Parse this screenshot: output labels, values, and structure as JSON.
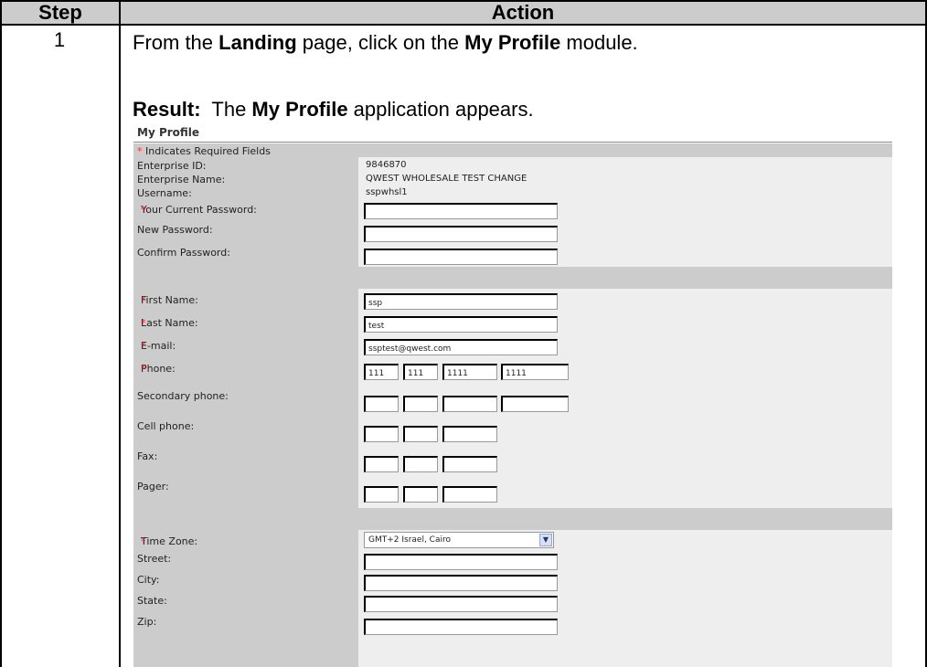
{
  "table": {
    "header_step": "Step",
    "header_action": "Action",
    "step_number": "1",
    "line1_a": "From the ",
    "line1_b": "Landing",
    "line1_c": " page, click on the ",
    "line1_d": "My Profile",
    "line1_e": " module.",
    "line2_a": "Result:",
    "line2_b": "  The ",
    "line2_c": "My Profile",
    "line2_d": " application appears."
  },
  "profile": {
    "title": "My Profile",
    "required_star": "*",
    "required_note": " Indicates Required Fields",
    "enterprise_id_label": "Enterprise ID:",
    "enterprise_id": "9846870",
    "enterprise_name_label": "Enterprise Name:",
    "enterprise_name": "QWEST WHOLESALE TEST CHANGE",
    "username_label": "Username:",
    "username": "sspwhsl1",
    "current_password_label": "Your Current Password:",
    "new_password_label": "New Password:",
    "confirm_password_label": "Confirm Password:",
    "first_name_label": "First Name:",
    "first_name": "ssp",
    "last_name_label": "Last Name:",
    "last_name": "test",
    "email_label": "E-mail:",
    "email": "ssptest@qwest.com",
    "phone_label": "Phone:",
    "phone": [
      "111",
      "111",
      "1111",
      "1111"
    ],
    "secondary_phone_label": "Secondary phone:",
    "cell_phone_label": "Cell phone:",
    "fax_label": "Fax:",
    "pager_label": "Pager:",
    "time_zone_label": "Time Zone:",
    "time_zone": "GMT+2 Israel, Cairo",
    "street_label": "Street:",
    "city_label": "City:",
    "state_label": "State:",
    "zip_label": "Zip:"
  },
  "icons": {
    "dropdown": "chevron-down-icon"
  }
}
